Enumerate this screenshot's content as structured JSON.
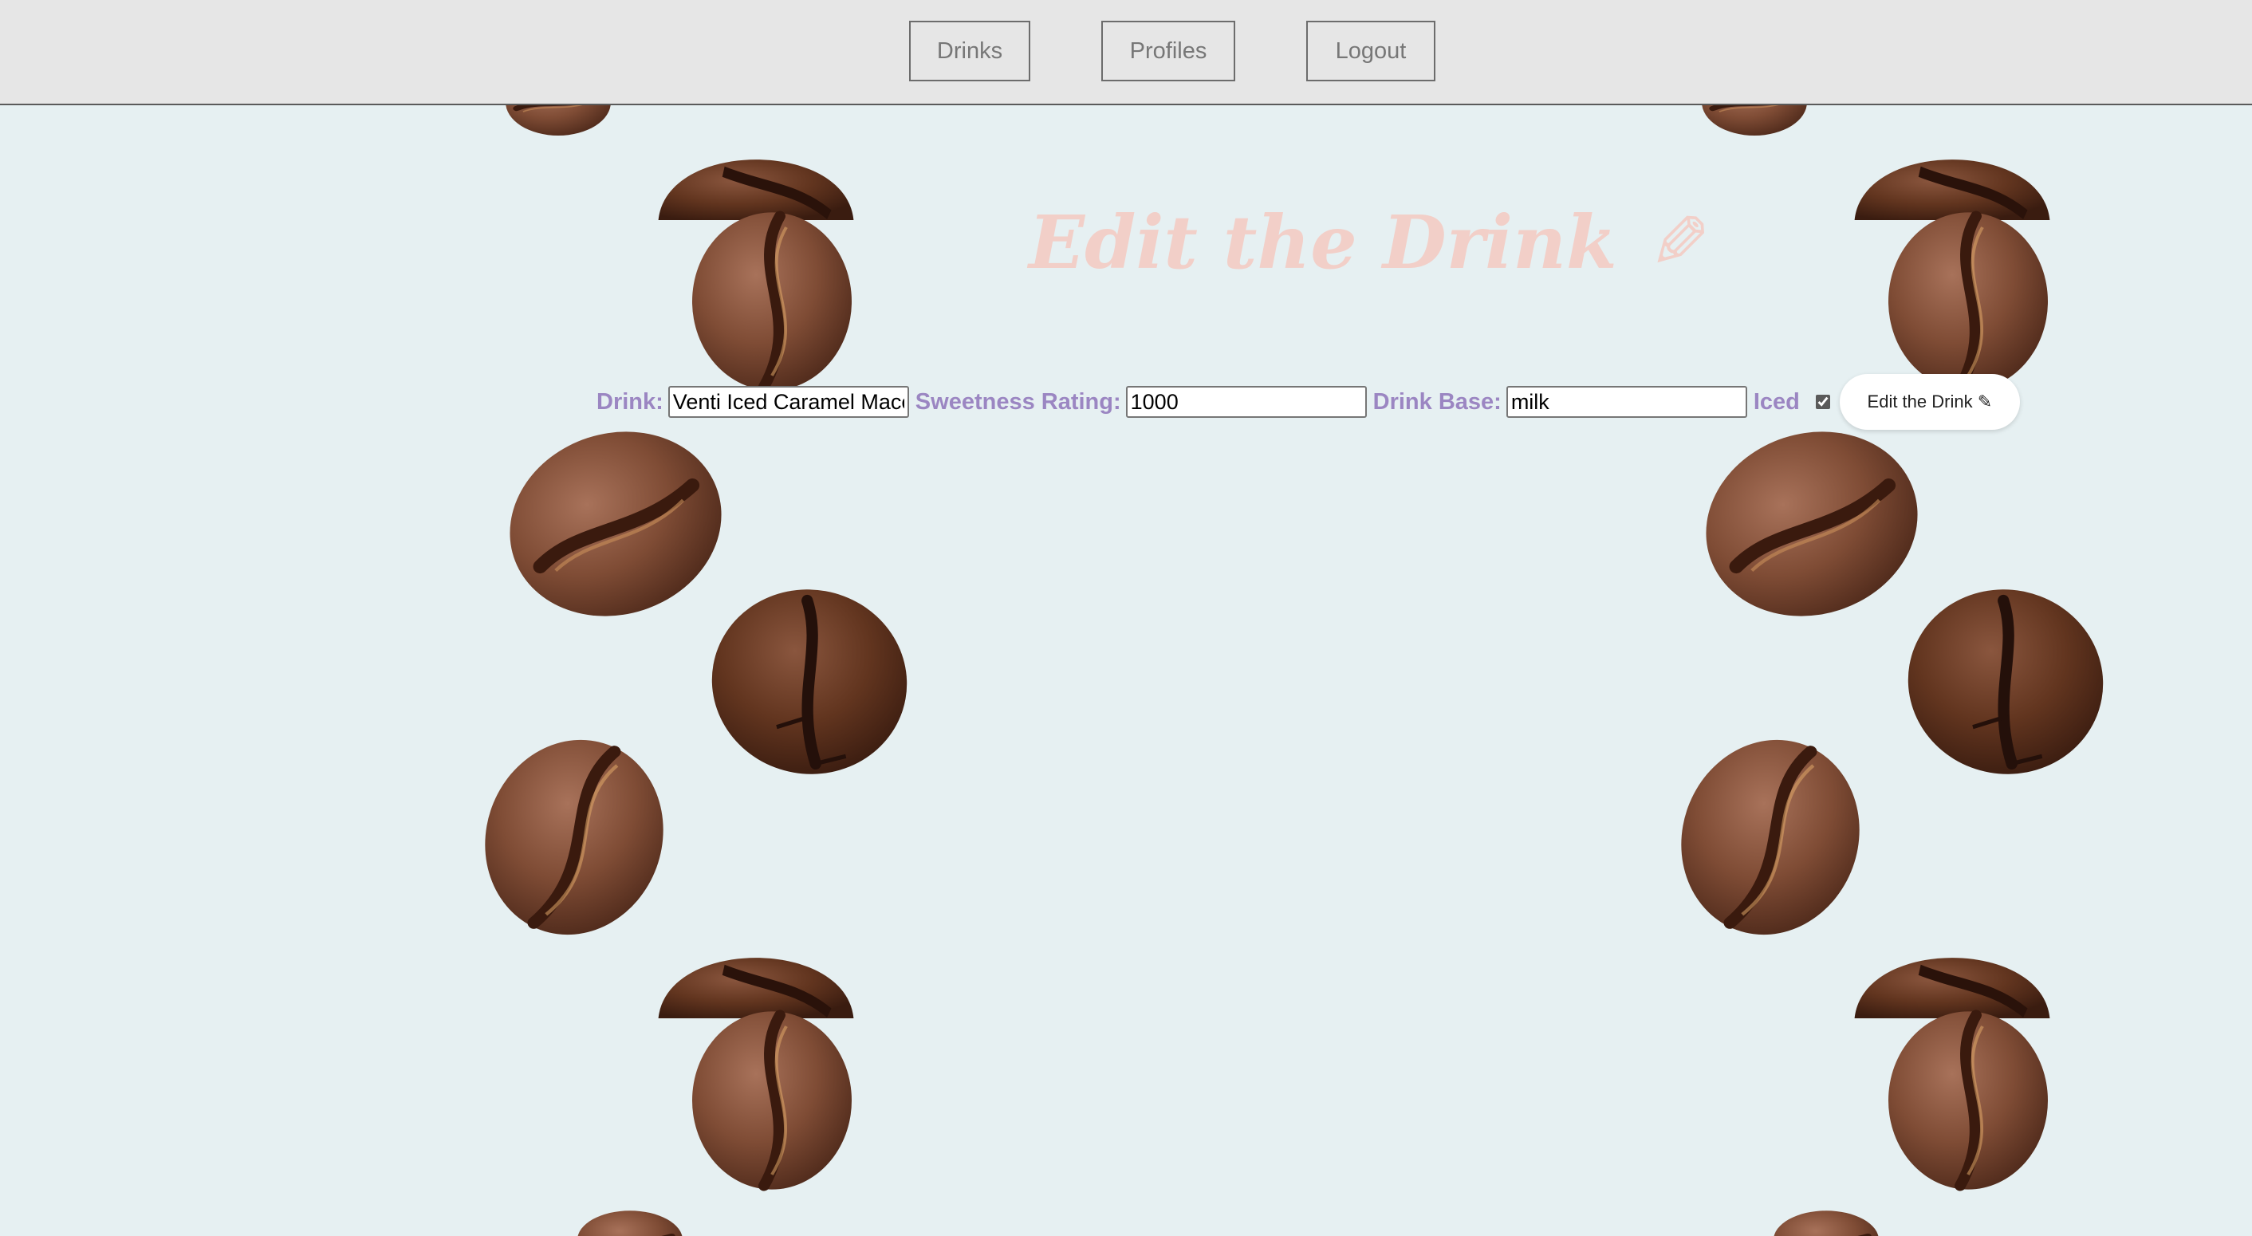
{
  "nav": {
    "drinks_label": "Drinks",
    "profiles_label": "Profiles",
    "logout_label": "Logout"
  },
  "page": {
    "title": "Edit the Drink",
    "title_icon": "pencil-icon"
  },
  "form": {
    "drink_label": "Drink:",
    "drink_value": "Venti Iced Caramel Macchiato",
    "sweetness_label": "Sweetness Rating:",
    "sweetness_value": "1000",
    "base_label": "Drink Base:",
    "base_value": "milk",
    "iced_label": "Iced",
    "iced_checked": true,
    "submit_label": "Edit the Drink ✎"
  },
  "colors": {
    "background": "#e6f0f2",
    "navbar": "#e6e6e6",
    "title": "#f2cfc8",
    "label": "#9b86c2",
    "bean": "#7a4a36"
  }
}
